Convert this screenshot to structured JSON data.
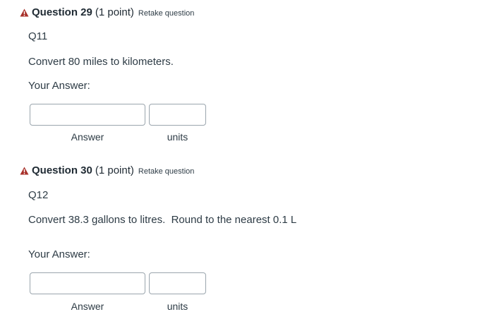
{
  "questions": [
    {
      "title": "Question 29",
      "points": "(1 point)",
      "retake_label": "Retake question",
      "code": "Q11",
      "prompt": "Convert 80 miles to kilometers.",
      "answer_prompt": "Your Answer:",
      "answer_value": "",
      "units_value": "",
      "answer_label": "Answer",
      "units_label": "units"
    },
    {
      "title": "Question 30",
      "points": "(1 point)",
      "retake_label": "Retake question",
      "code": "Q12",
      "prompt": "Convert 38.3 gallons to litres.  Round to the nearest 0.1 L",
      "answer_prompt": "Your Answer:",
      "answer_value": "",
      "units_value": "",
      "answer_label": "Answer",
      "units_label": "units"
    }
  ],
  "colors": {
    "warning_icon": "#a8302a",
    "text": "#2d3b45",
    "input_border": "#9aa5ad"
  },
  "icons": {
    "warning": "warning-triangle-icon"
  }
}
